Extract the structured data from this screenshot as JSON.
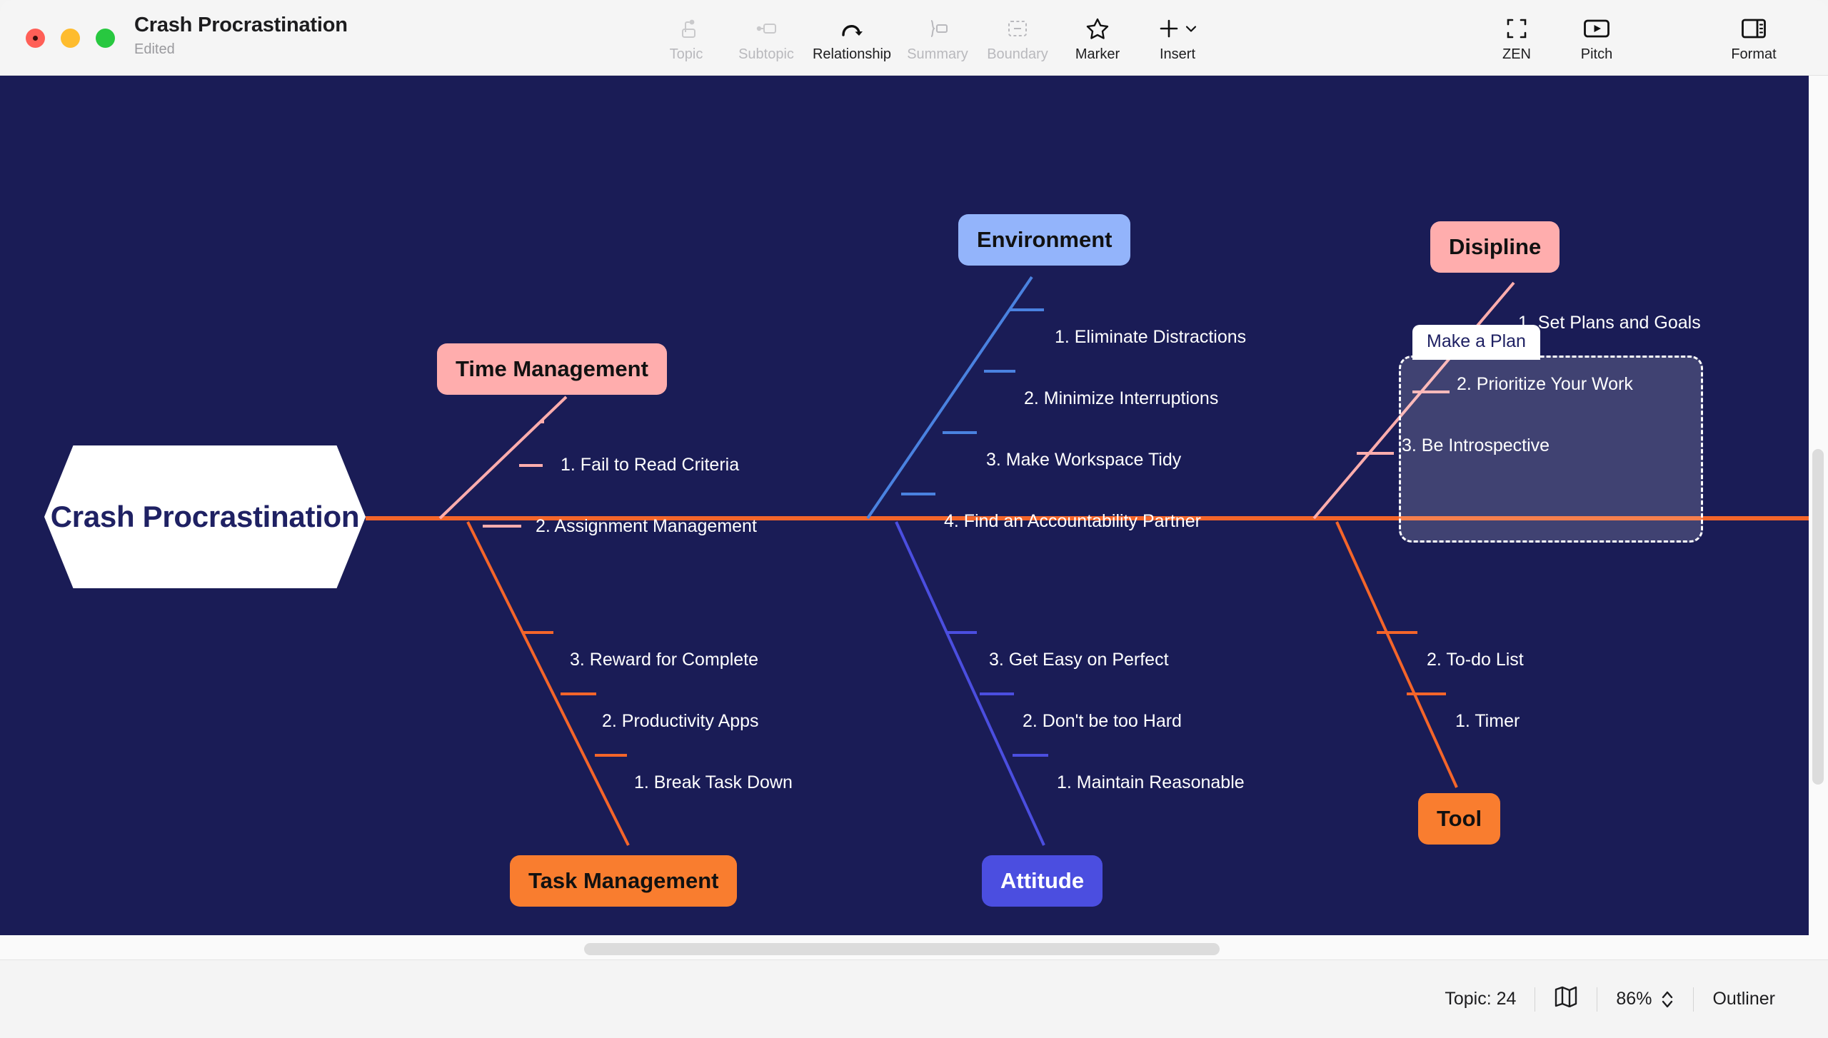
{
  "window": {
    "title": "Crash Procrastination",
    "subtitle": "Edited",
    "bg_canvas": "#1a1c56",
    "chrome_bg": "#f4f4f4"
  },
  "traffic_lights": [
    {
      "name": "close",
      "color": "#ff5f57"
    },
    {
      "name": "minimize",
      "color": "#febc2e"
    },
    {
      "name": "zoom",
      "color": "#28c840"
    }
  ],
  "toolbar": {
    "center": [
      {
        "label": "Topic",
        "icon": "topic-icon",
        "enabled": false
      },
      {
        "label": "Subtopic",
        "icon": "subtopic-icon",
        "enabled": false
      },
      {
        "label": "Relationship",
        "icon": "relationship-icon",
        "enabled": true
      },
      {
        "label": "Summary",
        "icon": "summary-icon",
        "enabled": false
      },
      {
        "label": "Boundary",
        "icon": "boundary-icon",
        "enabled": false
      },
      {
        "label": "Marker",
        "icon": "star-icon",
        "enabled": true
      },
      {
        "label": "Insert",
        "icon": "plus-chevron-icon",
        "enabled": true
      }
    ],
    "right": [
      {
        "label": "ZEN",
        "icon": "fullscreen-icon",
        "enabled": true
      },
      {
        "label": "Pitch",
        "icon": "play-video-icon",
        "enabled": true
      },
      {
        "label": "Format",
        "icon": "sidebar-panel-icon",
        "enabled": true
      }
    ]
  },
  "statusbar": {
    "topic_count_label": "Topic: 24",
    "map_icon": "map-icon",
    "zoom_level": "86%",
    "stepper_icon": "up-down-chevron-icon",
    "outliner_label": "Outliner"
  },
  "chart_data": {
    "type": "diagram",
    "diagram_kind": "fishbone",
    "title": "Crash Procrastination",
    "spine_color": "#f4652a",
    "root": {
      "label": "Crash Procrastination",
      "shape": "hexagon",
      "fill": "#ffffff",
      "text_color": "#1f2163"
    },
    "branches": [
      {
        "label": "Time Management",
        "side": "top",
        "fill": "#ffadad",
        "text_color": "#111111",
        "line_color": "#ffadad",
        "items": [
          "1. Fail to Read Criteria",
          "2. Assignment Management"
        ]
      },
      {
        "label": "Task Management",
        "side": "bottom",
        "fill": "#f97d2f",
        "text_color": "#111111",
        "line_color": "#f4652a",
        "items": [
          "3. Reward for Complete",
          "2. Productivity Apps",
          "1. Break Task Down"
        ]
      },
      {
        "label": "Environment",
        "side": "top",
        "fill": "#93b4fb",
        "text_color": "#111111",
        "line_color": "#4a82e0",
        "items": [
          "1. Eliminate Distractions",
          "2. Minimize Interruptions",
          "3. Make Workspace Tidy",
          "4. Find an Accountability Partner"
        ]
      },
      {
        "label": "Attitude",
        "side": "bottom",
        "fill": "#4b4ee0",
        "text_color": "#ffffff",
        "line_color": "#4b4ee0",
        "items": [
          "3. Get Easy on Perfect",
          "2. Don't be too Hard",
          "1. Maintain Reasonable"
        ]
      },
      {
        "label": "Disipline",
        "side": "top",
        "fill": "#ffadad",
        "text_color": "#111111",
        "line_color": "#ffadad",
        "items": [
          "1. Set Plans and Goals",
          "2. Prioritize Your Work",
          "3. Be Introspective"
        ]
      },
      {
        "label": "Tool",
        "side": "bottom",
        "fill": "#f97d2f",
        "text_color": "#111111",
        "line_color": "#f4652a",
        "items": [
          "2. To-do List",
          "1. Timer"
        ]
      }
    ],
    "boundary": {
      "label": "Make a Plan",
      "style": "dashed",
      "border_color": "#ffffff",
      "fill": "rgba(255,255,255,0.17)",
      "encloses": [
        "1. Set Plans and Goals",
        "2. Prioritize Your Work",
        "3. Be Introspective"
      ]
    }
  }
}
